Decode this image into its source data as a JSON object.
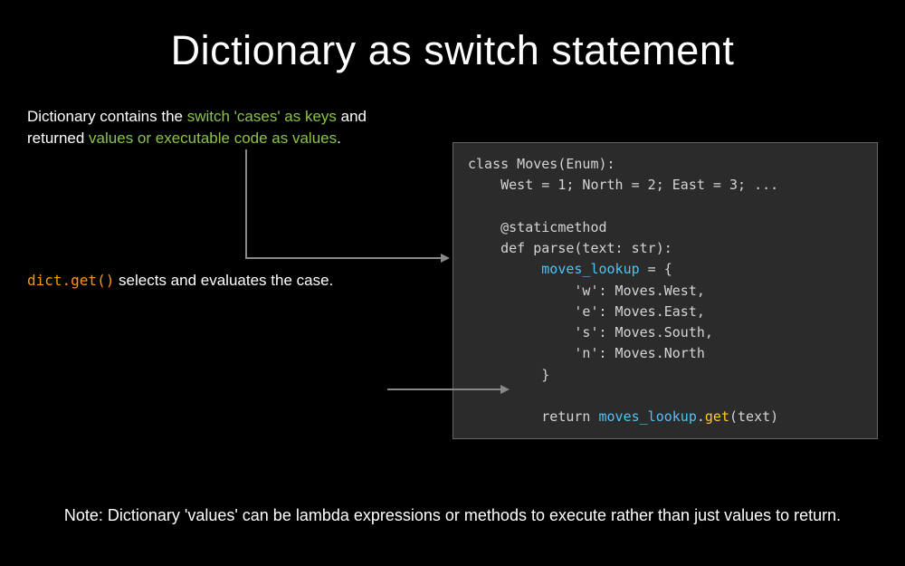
{
  "title": "Dictionary as switch statement",
  "annotation1": {
    "pre1": "Dictionary contains the ",
    "green1": "switch 'cases' as keys",
    "mid1": " and",
    "pre2": "returned ",
    "green2": "values or executable code as values",
    "post2": "."
  },
  "code": {
    "line1a": "class Moves(Enum):",
    "line2": "    West = 1; North = 2; East = 3; ...",
    "line3": "",
    "line4": "    @staticmethod",
    "line5": "    def parse(text: str):",
    "line6a": "         ",
    "line6b": "moves_lookup",
    "line6c": " = {",
    "line7": "             'w': Moves.West,",
    "line8": "             'e': Moves.East,",
    "line9": "             's': Moves.South,",
    "line10": "             'n': Moves.North",
    "line11": "         }",
    "line12": "",
    "line13a": "         return ",
    "line13b": "moves_lookup",
    "line13c": ".",
    "line13d": "get",
    "line13e": "(text)"
  },
  "annotation2": {
    "orange": "dict.get()",
    "text": "  selects and evaluates the case."
  },
  "note": "Note: Dictionary 'values' can be lambda expressions or methods to execute rather than just values to return."
}
